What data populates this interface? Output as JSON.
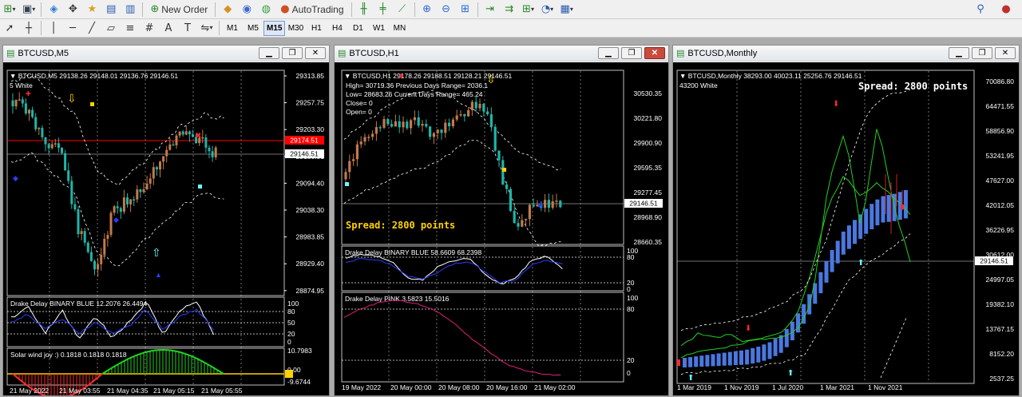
{
  "toolbar": {
    "new_order_label": "New Order",
    "autotrading_label": "AutoTrading"
  },
  "timeframes": [
    "M1",
    "M5",
    "M15",
    "M30",
    "H1",
    "H4",
    "D1",
    "W1",
    "MN"
  ],
  "active_timeframe": "M15",
  "colors": {
    "bull_candle": "#1fb5a8",
    "bear_candle": "#c37a4a",
    "grid": "#ffffff",
    "axis_text": "#ffffff",
    "bid_line": "#ff0000",
    "spread_text": "#ffd100",
    "osc_blue": "#2b3cff",
    "osc_white": "#ffffff",
    "pink": "#e0207a",
    "green_line": "#22d022",
    "volume_blue": "#4a78e0"
  },
  "windows": [
    {
      "title": "BTCUSD,M5",
      "header": "BTCUSD,M5  29138.26 29148.01 29136.76 29146.51",
      "subheader": "5 White",
      "price_ticks": [
        "29313.85",
        "29257.75",
        "29203.30",
        "29150.51",
        "29094.40",
        "29038.30",
        "28983.85",
        "28929.40",
        "28874.95"
      ],
      "bid_label": "29174.51",
      "current_price": "29146.51",
      "osc1_label": "Drake Delay BINARY BLUE 12.2076 26.4494",
      "osc1_ticks": [
        "100",
        "80",
        "50",
        "20",
        "0"
      ],
      "osc2_label": "Solar wind joy :) 0.1818 0.1818 0.1818",
      "osc2_ticks": [
        "10.7983",
        "0.00",
        "-9.6744"
      ],
      "time_ticks": [
        "21 May 2022",
        "21 May 03:55",
        "21 May 04:35",
        "21 May 05:15",
        "21 May 05:55"
      ]
    },
    {
      "title": "BTCUSD,H1",
      "header": "BTCUSD,H1  29178.26 29188.51 29128.21 29146.51",
      "info_lines": [
        "High= 30719.36   Previous Days Range= 2036.1",
        "Low= 28683.26   Current Days Range= 465.24",
        "Close= 0",
        "Open= 0"
      ],
      "price_ticks": [
        "30530.35",
        "30221.80",
        "29900.90",
        "29595.35",
        "29277.45",
        "28968.90",
        "28660.35"
      ],
      "current_price": "29146.51",
      "spread_text": "Spread: 2800 points",
      "osc1_label": "Drake Delay BINARY BLUE 58.6609 68.2398",
      "osc1_ticks": [
        "100",
        "80",
        "20",
        "0"
      ],
      "osc2_label": "Drake Delay PINK 3.5823 15.5016",
      "osc2_ticks": [
        "100",
        "80",
        "20",
        "0"
      ],
      "time_ticks": [
        "19 May 2022",
        "20 May 00:00",
        "20 May 08:00",
        "20 May 16:00",
        "21 May 02:00"
      ]
    },
    {
      "title": "BTCUSD,Monthly",
      "header": "BTCUSD,Monthly  38293.00 40023.11 25256.76 29146.51",
      "subheader": "43200 White",
      "spread_text": "Spread: 2800 points",
      "price_ticks": [
        "70086.80",
        "64471.55",
        "58856.90",
        "53241.95",
        "47627.00",
        "42012.05",
        "36226.95",
        "30612.00",
        "24997.05",
        "19382.10",
        "13767.15",
        "8152.20",
        "2537.25"
      ],
      "current_price": "29146.51",
      "time_ticks": [
        "1 Mar 2019",
        "1 Nov 2019",
        "1 Jul 2020",
        "1 Mar 2021",
        "1 Nov 2021"
      ]
    }
  ]
}
